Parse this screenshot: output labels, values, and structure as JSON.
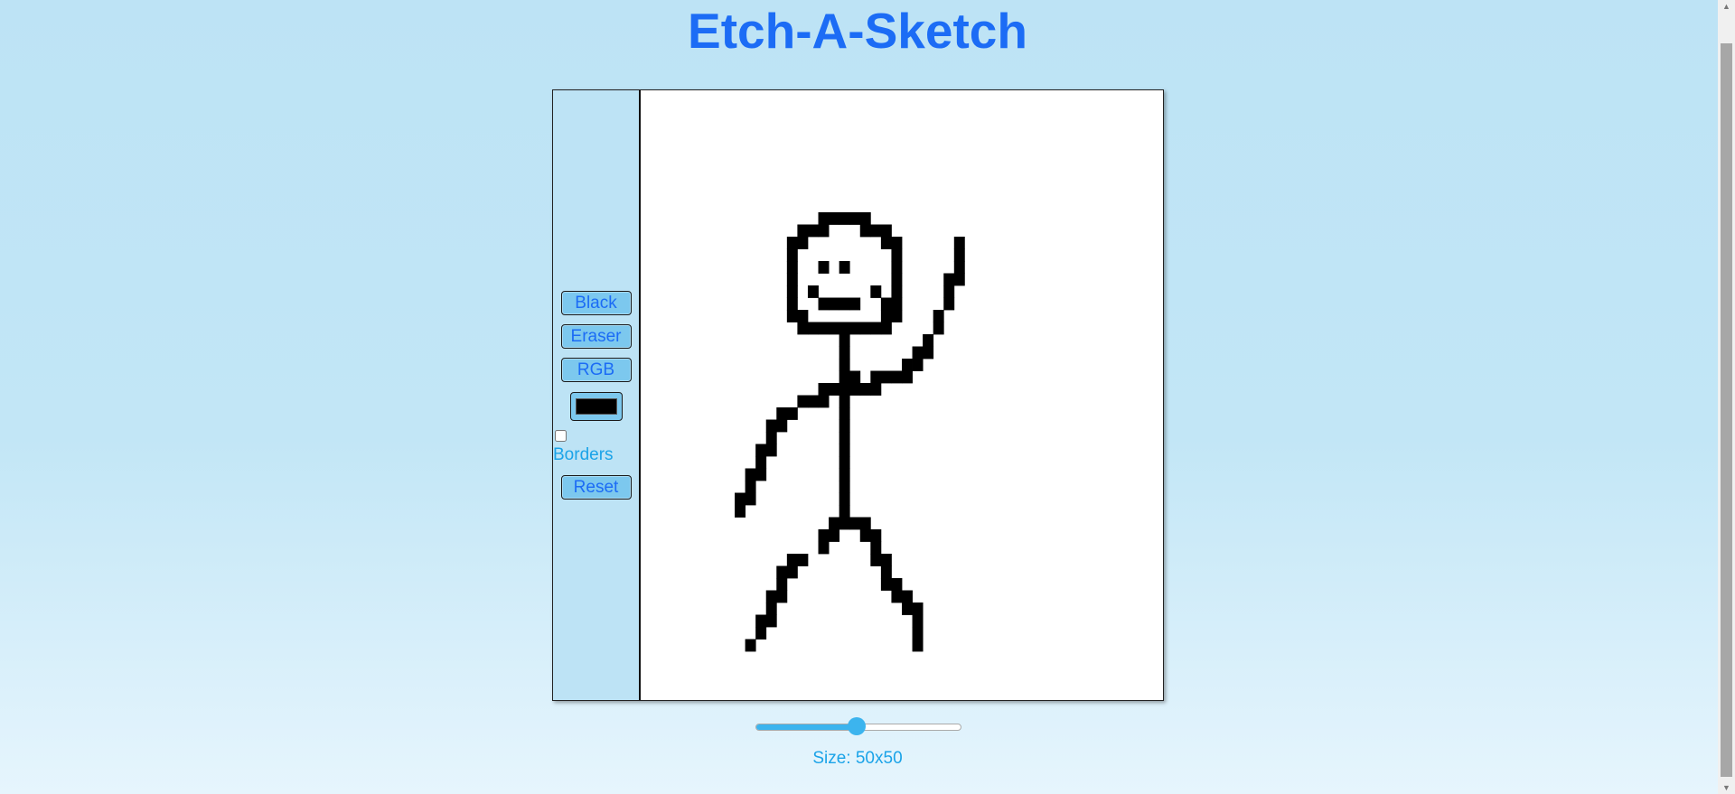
{
  "title": "Etch-A-Sketch",
  "panel": {
    "black_label": "Black",
    "eraser_label": "Eraser",
    "rgb_label": "RGB",
    "color_value": "#000000",
    "borders_label": "Borders",
    "borders_checked": false,
    "reset_label": "Reset"
  },
  "grid": {
    "size": 50,
    "ink_color": "#000000",
    "filled_cells": [
      [
        17,
        10
      ],
      [
        18,
        10
      ],
      [
        19,
        10
      ],
      [
        20,
        10
      ],
      [
        21,
        10
      ],
      [
        15,
        11
      ],
      [
        16,
        11
      ],
      [
        17,
        11
      ],
      [
        21,
        11
      ],
      [
        22,
        11
      ],
      [
        23,
        11
      ],
      [
        14,
        12
      ],
      [
        15,
        12
      ],
      [
        23,
        12
      ],
      [
        24,
        12
      ],
      [
        30,
        12
      ],
      [
        14,
        13
      ],
      [
        24,
        13
      ],
      [
        30,
        13
      ],
      [
        14,
        14
      ],
      [
        17,
        14
      ],
      [
        19,
        14
      ],
      [
        24,
        14
      ],
      [
        30,
        14
      ],
      [
        14,
        15
      ],
      [
        24,
        15
      ],
      [
        29,
        15
      ],
      [
        30,
        15
      ],
      [
        14,
        16
      ],
      [
        16,
        16
      ],
      [
        22,
        16
      ],
      [
        24,
        16
      ],
      [
        29,
        16
      ],
      [
        14,
        17
      ],
      [
        17,
        17
      ],
      [
        18,
        17
      ],
      [
        19,
        17
      ],
      [
        20,
        17
      ],
      [
        23,
        17
      ],
      [
        24,
        17
      ],
      [
        29,
        17
      ],
      [
        14,
        18
      ],
      [
        15,
        18
      ],
      [
        23,
        18
      ],
      [
        24,
        18
      ],
      [
        28,
        18
      ],
      [
        15,
        19
      ],
      [
        16,
        19
      ],
      [
        17,
        19
      ],
      [
        18,
        19
      ],
      [
        19,
        19
      ],
      [
        20,
        19
      ],
      [
        21,
        19
      ],
      [
        22,
        19
      ],
      [
        23,
        19
      ],
      [
        28,
        19
      ],
      [
        19,
        20
      ],
      [
        27,
        20
      ],
      [
        19,
        21
      ],
      [
        26,
        21
      ],
      [
        27,
        21
      ],
      [
        19,
        22
      ],
      [
        25,
        22
      ],
      [
        26,
        22
      ],
      [
        19,
        23
      ],
      [
        20,
        23
      ],
      [
        22,
        23
      ],
      [
        23,
        23
      ],
      [
        24,
        23
      ],
      [
        25,
        23
      ],
      [
        17,
        24
      ],
      [
        18,
        24
      ],
      [
        19,
        24
      ],
      [
        20,
        24
      ],
      [
        21,
        24
      ],
      [
        22,
        24
      ],
      [
        15,
        25
      ],
      [
        16,
        25
      ],
      [
        17,
        25
      ],
      [
        19,
        25
      ],
      [
        13,
        26
      ],
      [
        14,
        26
      ],
      [
        19,
        26
      ],
      [
        12,
        27
      ],
      [
        13,
        27
      ],
      [
        19,
        27
      ],
      [
        12,
        28
      ],
      [
        19,
        28
      ],
      [
        11,
        29
      ],
      [
        12,
        29
      ],
      [
        19,
        29
      ],
      [
        11,
        30
      ],
      [
        19,
        30
      ],
      [
        10,
        31
      ],
      [
        11,
        31
      ],
      [
        19,
        31
      ],
      [
        10,
        32
      ],
      [
        19,
        32
      ],
      [
        9,
        33
      ],
      [
        10,
        33
      ],
      [
        19,
        33
      ],
      [
        9,
        34
      ],
      [
        19,
        34
      ],
      [
        18,
        35
      ],
      [
        19,
        35
      ],
      [
        20,
        35
      ],
      [
        21,
        35
      ],
      [
        17,
        36
      ],
      [
        18,
        36
      ],
      [
        21,
        36
      ],
      [
        22,
        36
      ],
      [
        17,
        37
      ],
      [
        22,
        37
      ],
      [
        14,
        38
      ],
      [
        15,
        38
      ],
      [
        22,
        38
      ],
      [
        23,
        38
      ],
      [
        13,
        39
      ],
      [
        14,
        39
      ],
      [
        23,
        39
      ],
      [
        13,
        40
      ],
      [
        23,
        40
      ],
      [
        24,
        40
      ],
      [
        12,
        41
      ],
      [
        13,
        41
      ],
      [
        24,
        41
      ],
      [
        25,
        41
      ],
      [
        12,
        42
      ],
      [
        25,
        42
      ],
      [
        26,
        42
      ],
      [
        11,
        43
      ],
      [
        12,
        43
      ],
      [
        26,
        43
      ],
      [
        11,
        44
      ],
      [
        26,
        44
      ],
      [
        10,
        45
      ],
      [
        26,
        45
      ]
    ]
  },
  "slider": {
    "value": 50,
    "min": 1,
    "max": 100,
    "fill_color": "#3cb4ee"
  },
  "size_label": "Size: 50x50"
}
